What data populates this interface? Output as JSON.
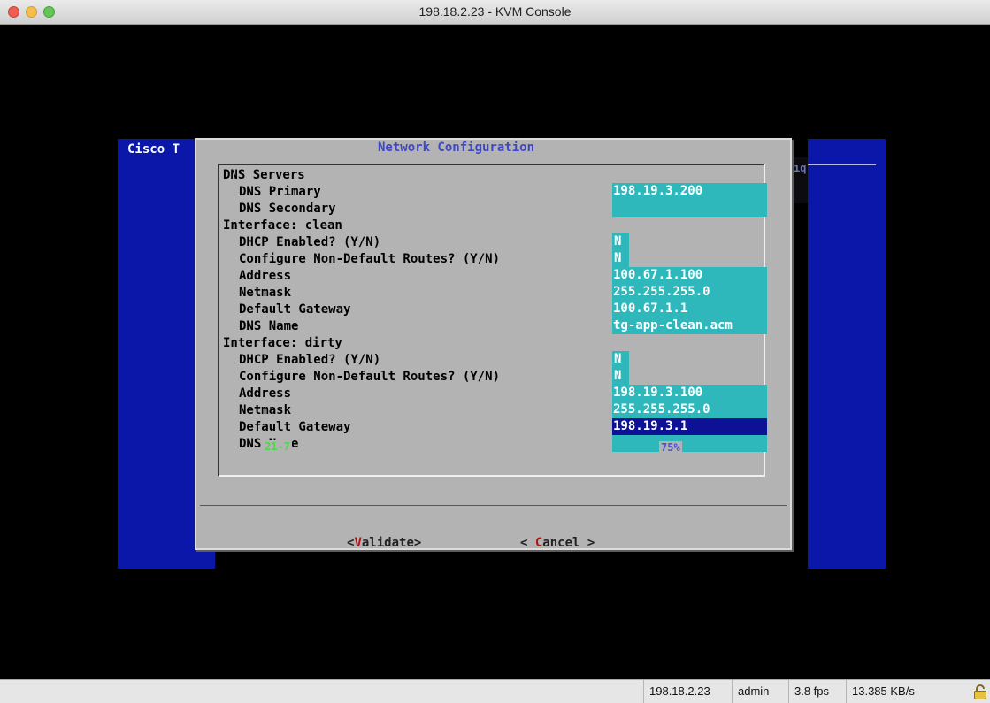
{
  "window": {
    "title": "198.18.2.23 - KVM Console"
  },
  "console": {
    "app_title_fragment": "Cisco T",
    "right_fragment": "ıq",
    "dialog": {
      "title": "Network Configuration",
      "sections": [
        {
          "heading": "DNS Servers",
          "fields": [
            {
              "label": "DNS Primary",
              "value": "198.19.3.200",
              "kind": "full"
            },
            {
              "label": "DNS Secondary",
              "value": "",
              "kind": "full"
            }
          ]
        },
        {
          "heading": "Interface: clean",
          "fields": [
            {
              "label": "DHCP Enabled? (Y/N)",
              "value": "N",
              "kind": "narrow"
            },
            {
              "label": "Configure Non-Default Routes? (Y/N)",
              "value": "N",
              "kind": "narrow"
            },
            {
              "label": "Address",
              "value": "100.67.1.100",
              "kind": "full"
            },
            {
              "label": "Netmask",
              "value": "255.255.255.0",
              "kind": "full"
            },
            {
              "label": "Default Gateway",
              "value": "100.67.1.1",
              "kind": "full"
            },
            {
              "label": "DNS Name",
              "value": "tg-app-clean.acm",
              "kind": "full"
            }
          ]
        },
        {
          "heading": "Interface: dirty",
          "fields": [
            {
              "label": "DHCP Enabled? (Y/N)",
              "value": "N",
              "kind": "narrow"
            },
            {
              "label": "Configure Non-Default Routes? (Y/N)",
              "value": "N",
              "kind": "narrow"
            },
            {
              "label": "Address",
              "value": "198.19.3.100",
              "kind": "full"
            },
            {
              "label": "Netmask",
              "value": "255.255.255.0",
              "kind": "full"
            },
            {
              "label": "Default Gateway",
              "value": "198.19.3.1",
              "kind": "full",
              "selected": true
            },
            {
              "label": "DNS Name",
              "value": "",
              "kind": "full"
            }
          ]
        }
      ],
      "scroll_position": "21-7",
      "scroll_percent": "75%",
      "buttons": {
        "validate": {
          "open": "<",
          "hotkey": "V",
          "rest": "alidate",
          "close": ">"
        },
        "cancel": {
          "open": "< ",
          "hotkey": "C",
          "rest": "ancel",
          "close": " >"
        }
      }
    }
  },
  "statusbar": {
    "host": "198.18.2.23",
    "user": "admin",
    "fps": "3.8 fps",
    "rate": "13.385 KB/s",
    "lock_icon": "lock-icon"
  },
  "colors": {
    "field_bg": "#2fb8bc",
    "field_selected_bg": "#0c1196",
    "dialog_bg": "#b3b3b3",
    "title_fg": "#3f47c7",
    "hotkey_fg": "#b01212",
    "blue_pane": "#0a17a8"
  }
}
